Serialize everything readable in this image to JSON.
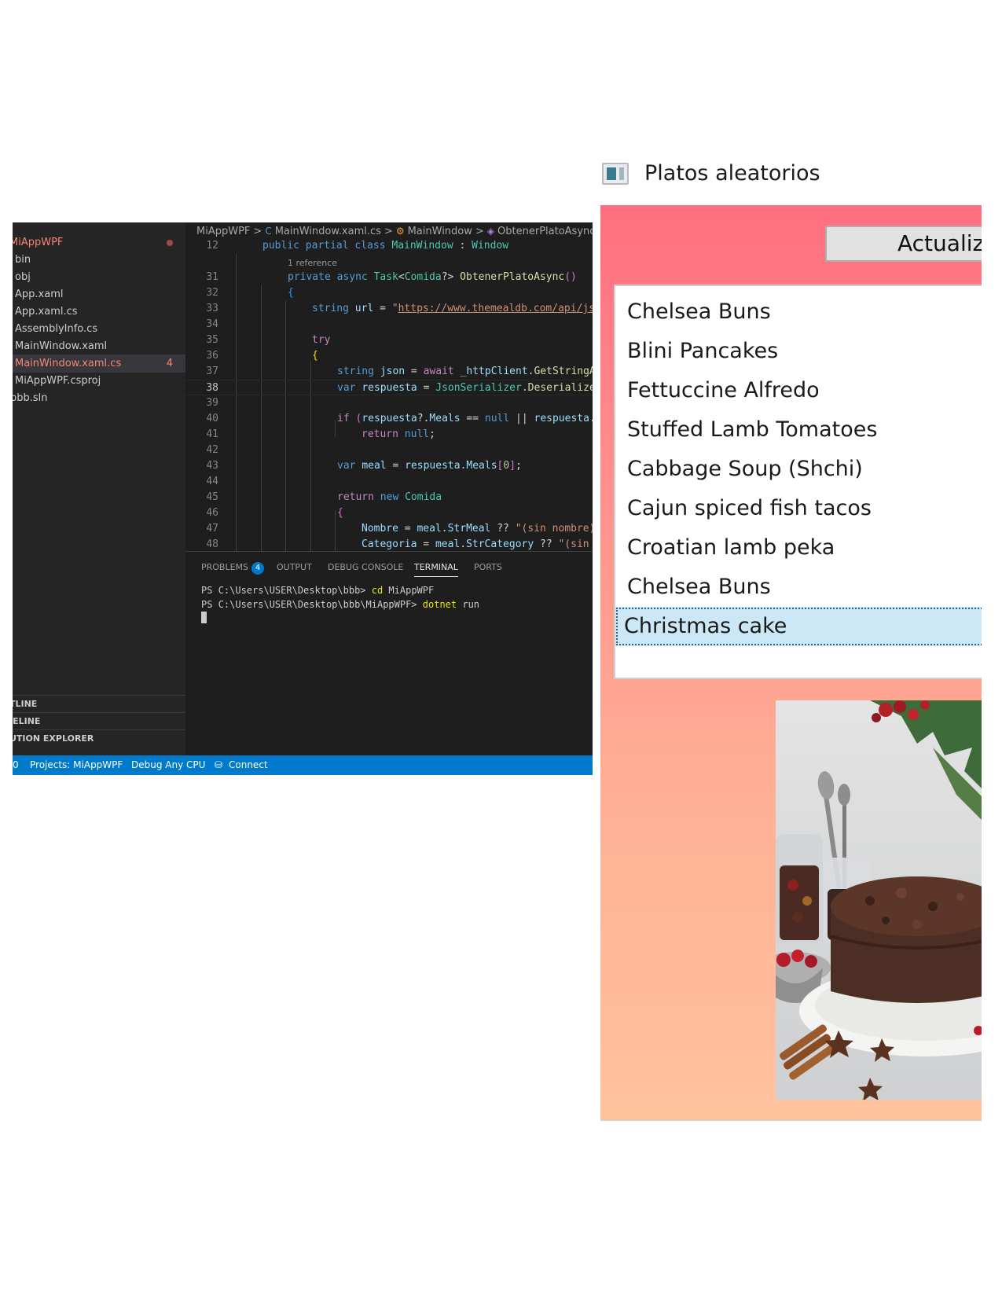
{
  "vscode": {
    "explorer": {
      "items": [
        {
          "label": "MiAppWPF",
          "state": "root-error-dot"
        },
        {
          "label": "bin"
        },
        {
          "label": "obj"
        },
        {
          "label": "App.xaml"
        },
        {
          "label": "App.xaml.cs"
        },
        {
          "label": "AssemblyInfo.cs"
        },
        {
          "label": "MainWindow.xaml"
        },
        {
          "label": "MainWindow.xaml.cs",
          "badge": "4",
          "state": "active-error"
        },
        {
          "label": "MiAppWPF.csproj"
        },
        {
          "label": "bbb.sln"
        }
      ],
      "sections": [
        "TLINE",
        "IELINE",
        "UTION EXPLORER"
      ]
    },
    "breadcrumb": [
      "MiAppWPF",
      "MainWindow.xaml.cs",
      "MainWindow",
      "ObtenerPlatoAsync"
    ],
    "code": {
      "line_numbers": [
        "12",
        "31",
        "32",
        "33",
        "34",
        "35",
        "36",
        "37",
        "38",
        "39",
        "40",
        "41",
        "42",
        "43",
        "44",
        "45",
        "46",
        "47",
        "48"
      ],
      "reference_hint": "1 reference",
      "current_line": "38"
    },
    "panel": {
      "tabs": [
        "PROBLEMS",
        "OUTPUT",
        "DEBUG CONSOLE",
        "TERMINAL",
        "PORTS"
      ],
      "problems_count": "4",
      "active_tab": "TERMINAL",
      "terminal_lines": [
        {
          "prompt": "PS C:\\Users\\USER\\Desktop\\bbb> ",
          "command": "cd",
          "args": " MiAppWPF"
        },
        {
          "prompt": "PS C:\\Users\\USER\\Desktop\\bbb\\MiAppWPF> ",
          "command": "dotnet",
          "args": " run"
        }
      ]
    },
    "statusbar": {
      "left_count": "0",
      "project": "Projects: MiAppWPF",
      "config": "Debug Any CPU",
      "connect": "Connect"
    }
  },
  "wpf_window": {
    "title": "Platos aleatorios",
    "refresh_button_label": "Actualiz",
    "meals": [
      "Chelsea Buns",
      "Blini Pancakes",
      "Fettuccine Alfredo",
      "Stuffed Lamb Tomatoes",
      "Cabbage Soup (Shchi)",
      "Cajun spiced fish tacos",
      "Croatian lamb peka",
      "Chelsea Buns",
      "Christmas cake"
    ],
    "selected_meal": "Christmas cake",
    "photo": "christmas-cake-photo",
    "colors": {
      "gradient_top": "#ff6e80",
      "gradient_bottom": "#ffc39c",
      "selection": "#cce8f6"
    }
  }
}
